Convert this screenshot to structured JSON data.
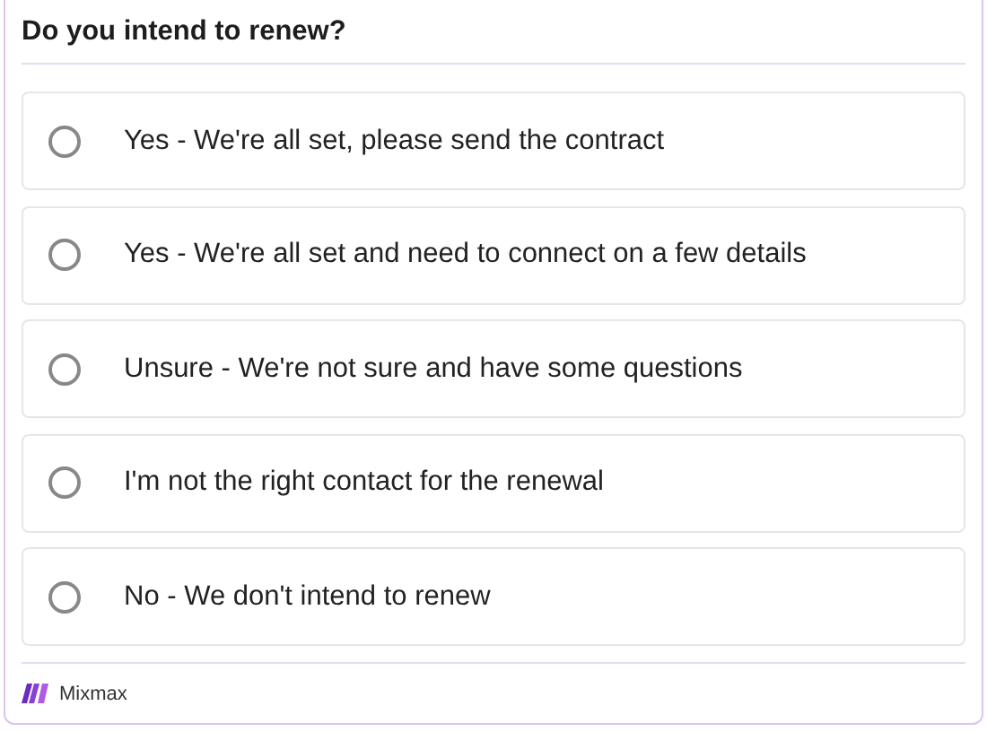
{
  "question": "Do you intend to renew?",
  "options": [
    {
      "label": "Yes - We're all set, please send the contract",
      "selected": false
    },
    {
      "label": "Yes - We're all set and need to connect on a few details",
      "selected": false
    },
    {
      "label": "Unsure - We're not sure and have some questions",
      "selected": false
    },
    {
      "label": "I'm not the right contact for the renewal",
      "selected": false
    },
    {
      "label": "No - We don't intend to renew",
      "selected": false
    }
  ],
  "footer": {
    "brand": "Mixmax"
  }
}
